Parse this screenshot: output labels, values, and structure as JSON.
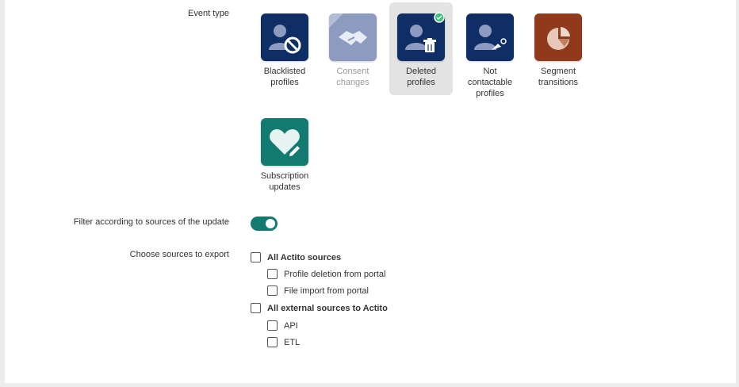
{
  "event_type_label": "Event type",
  "tiles": [
    {
      "caption_line1": "Blacklisted",
      "caption_line2": "profiles",
      "caption_line3": "",
      "color": "#0f2e66",
      "icon": "blacklist-icon",
      "state": "normal"
    },
    {
      "caption_line1": "Consent",
      "caption_line2": "changes",
      "caption_line3": "",
      "color": "#8c9bbf",
      "icon": "handshake-icon",
      "state": "disabled"
    },
    {
      "caption_line1": "Deleted",
      "caption_line2": "profiles",
      "caption_line3": "",
      "color": "#0f2e66",
      "icon": "delete-profile-icon",
      "state": "selected"
    },
    {
      "caption_line1": "Not",
      "caption_line2": "contactable",
      "caption_line3": "profiles",
      "color": "#0f2e66",
      "icon": "not-contactable-icon",
      "state": "normal"
    },
    {
      "caption_line1": "Segment",
      "caption_line2": "transitions",
      "caption_line3": "",
      "color": "#8f3a1c",
      "icon": "segment-icon",
      "state": "normal"
    },
    {
      "caption_line1": "Subscription",
      "caption_line2": "updates",
      "caption_line3": "",
      "color": "#137a72",
      "icon": "subscription-icon",
      "state": "normal"
    }
  ],
  "filter_label": "Filter according to sources of the update",
  "filter_enabled": true,
  "sources_label": "Choose sources to export",
  "sources": {
    "actito_all": "All Actito sources",
    "profile_deletion": "Profile deletion from portal",
    "file_import": "File import from portal",
    "external_all": "All external sources to Actito",
    "api": "API",
    "etl": "ETL"
  },
  "colors": {
    "accent": "#137a72",
    "selected_check": "#3cc47c"
  }
}
